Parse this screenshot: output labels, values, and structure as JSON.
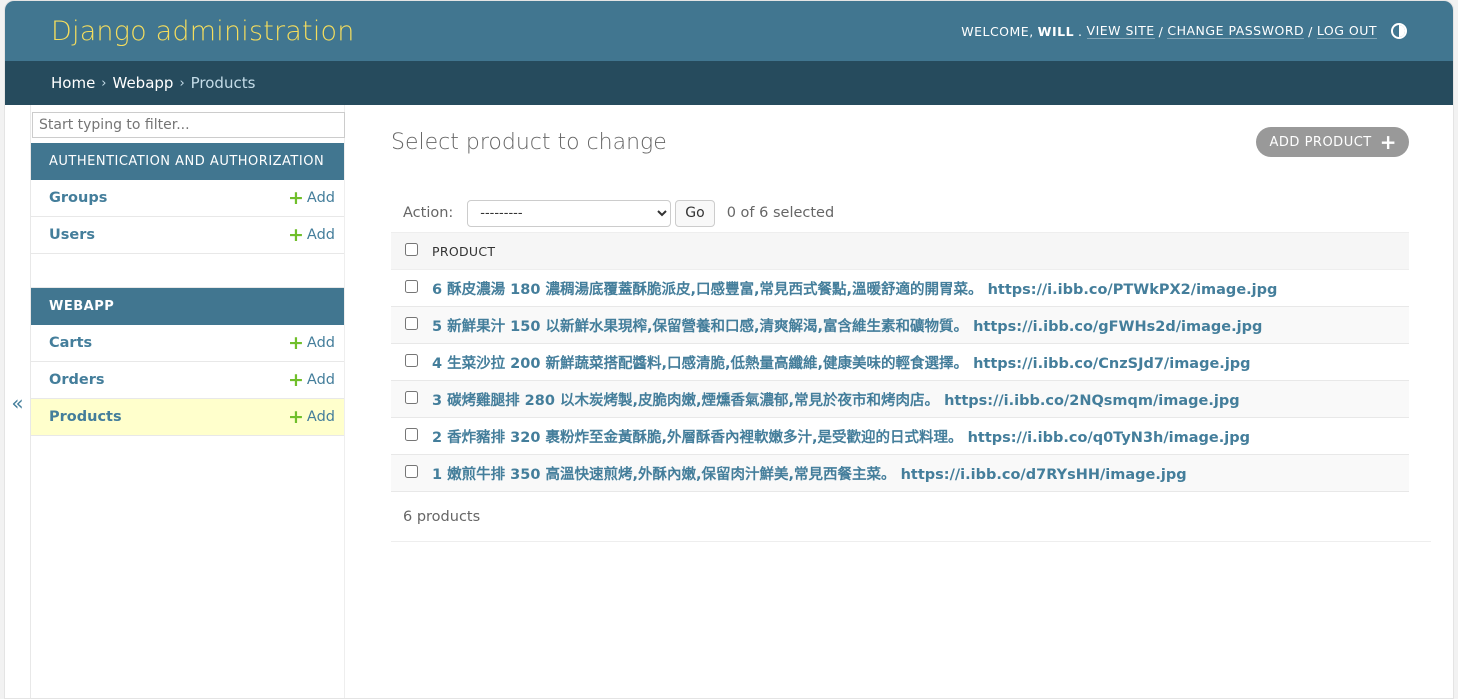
{
  "header": {
    "brand": "Django administration",
    "welcome": "Welcome,",
    "username": "Will",
    "view_site": "View site",
    "change_password": "Change password",
    "log_out": "Log out",
    "sep": "/"
  },
  "breadcrumbs": {
    "home": "Home",
    "app": "Webapp",
    "current": "Products",
    "sep": "›"
  },
  "sidebar": {
    "toggle": "«",
    "filter_placeholder": "Start typing to filter...",
    "modules": [
      {
        "caption": "Authentication and Authorization",
        "models": [
          {
            "name": "Groups",
            "add": "Add"
          },
          {
            "name": "Users",
            "add": "Add"
          }
        ]
      },
      {
        "caption": "Webapp",
        "models": [
          {
            "name": "Carts",
            "add": "Add"
          },
          {
            "name": "Orders",
            "add": "Add"
          },
          {
            "name": "Products",
            "add": "Add",
            "current": true
          }
        ]
      }
    ]
  },
  "content": {
    "title": "Select product to change",
    "add_button": "Add product",
    "action_label": "Action:",
    "action_selected": "---------",
    "go_label": "Go",
    "selected_count": "0 of 6 selected",
    "column_header": "Product",
    "rows": [
      "6 酥皮濃湯 180 濃稠湯底覆蓋酥脆派皮,口感豐富,常見西式餐點,溫暖舒適的開胃菜。 https://i.ibb.co/PTWkPX2/image.jpg",
      "5 新鮮果汁 150 以新鮮水果現榨,保留營養和口感,清爽解渴,富含維生素和礦物質。 https://i.ibb.co/gFWHs2d/image.jpg",
      "4 生菜沙拉 200 新鮮蔬菜搭配醬料,口感清脆,低熱量高纖維,健康美味的輕食選擇。 https://i.ibb.co/CnzSJd7/image.jpg",
      "3 碳烤雞腿排 280 以木炭烤製,皮脆肉嫩,煙燻香氣濃郁,常見於夜市和烤肉店。 https://i.ibb.co/2NQsmqm/image.jpg",
      "2 香炸豬排 320 裹粉炸至金黃酥脆,外層酥香內裡軟嫩多汁,是受歡迎的日式料理。 https://i.ibb.co/q0TyN3h/image.jpg",
      "1 嫩煎牛排 350 高溫快速煎烤,外酥內嫩,保留肉汁鮮美,常見西餐主菜。 https://i.ibb.co/d7RYsHH/image.jpg"
    ],
    "paginator": "6 products"
  },
  "colors": {
    "header_bg": "#417690",
    "breadcrumb_bg": "#264b5d",
    "brand": "#f5dd5d",
    "link": "#447e9b",
    "add_green": "#70bf2b",
    "current_row": "#ffffcc"
  }
}
